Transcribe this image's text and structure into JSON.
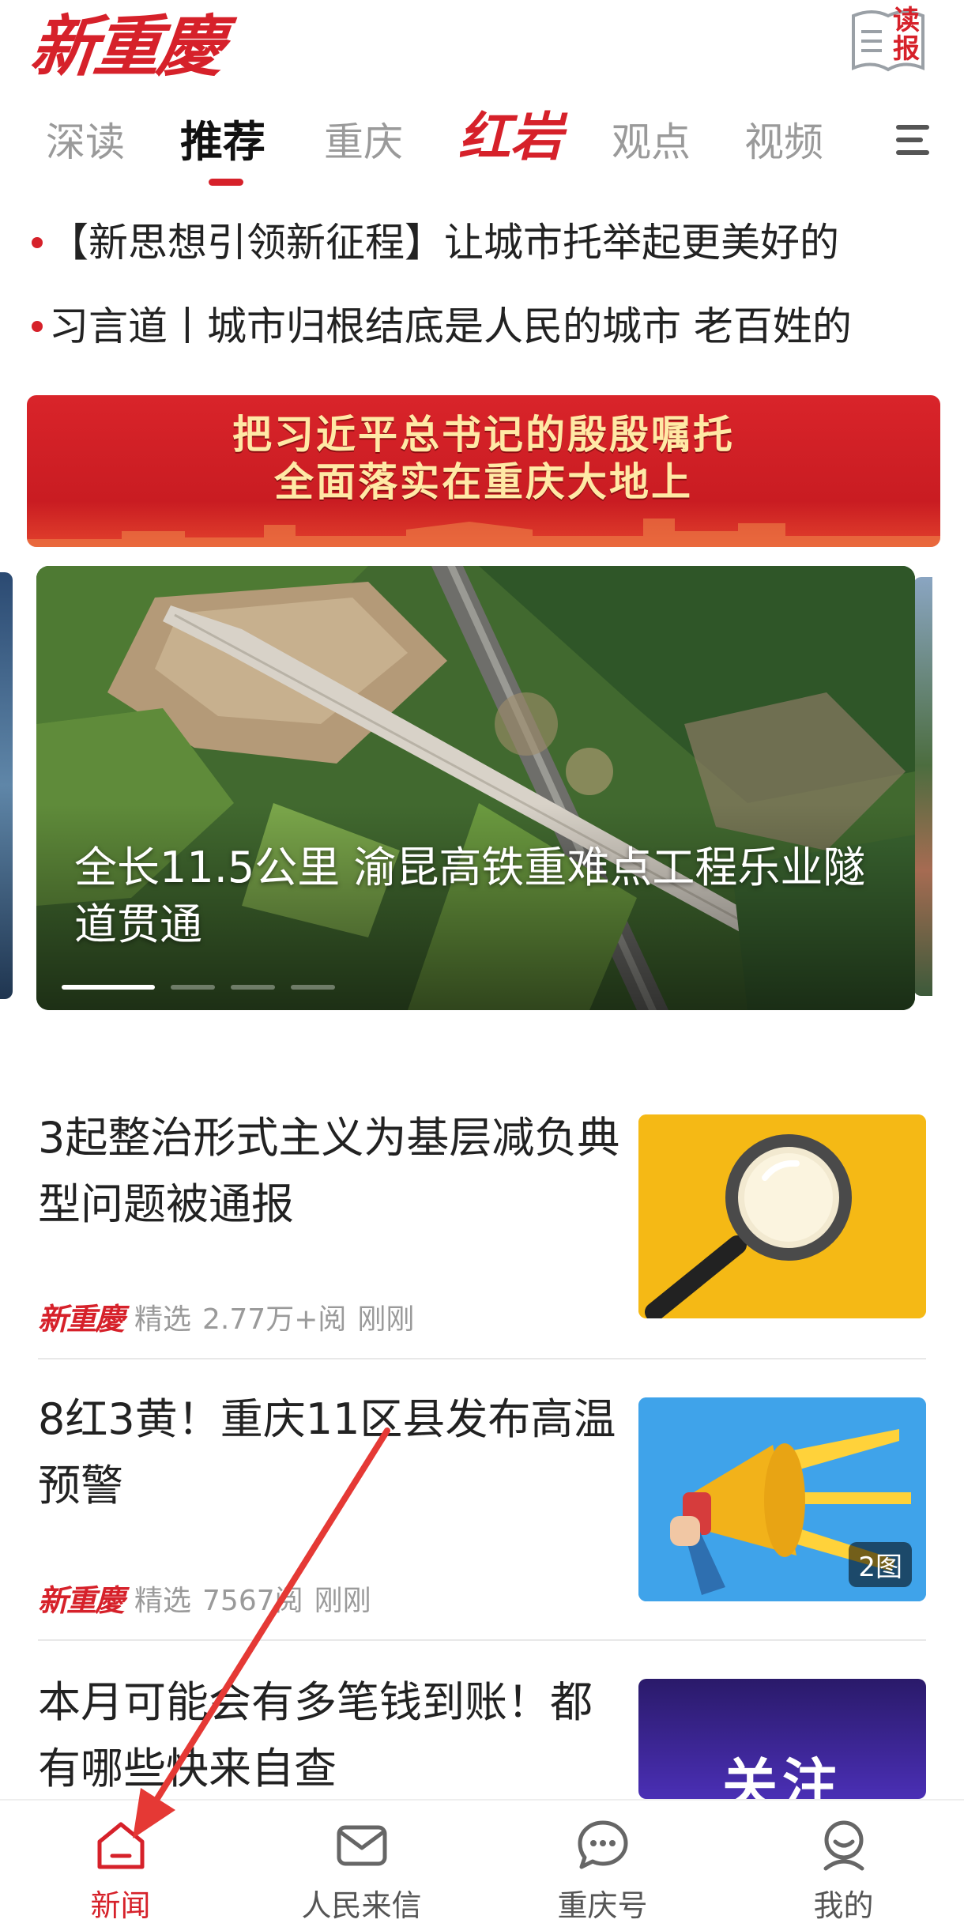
{
  "app": {
    "logo": "新重慶",
    "read_button_label": "读报"
  },
  "tabs": [
    {
      "label": "深读",
      "active": false
    },
    {
      "label": "推荐",
      "active": true
    },
    {
      "label": "重庆",
      "active": false
    },
    {
      "label": "红岩",
      "active": false,
      "brand": true
    },
    {
      "label": "观点",
      "active": false
    },
    {
      "label": "视频",
      "active": false
    }
  ],
  "headlines": [
    "【新思想引领新征程】让城市托举起更美好的",
    "习言道丨城市归根结底是人民的城市 老百姓的"
  ],
  "banner": {
    "line1": "把习近平总书记的殷殷嘱托",
    "line2": "全面落实在重庆大地上"
  },
  "carousel": {
    "caption": "全长11.5公里 渝昆高铁重难点工程乐业隧道贯通",
    "slide_count": 4,
    "active_index": 0
  },
  "articles": [
    {
      "title": "3起整治形式主义为基层减负典型问题被通报",
      "source": "新重慶",
      "tag": "精选",
      "reads": "2.77万+阅",
      "time": "刚刚",
      "thumb": "magnifier-icon"
    },
    {
      "title": "8红3黄！重庆11区县发布高温预警",
      "source": "新重慶",
      "tag": "精选",
      "reads": "7567阅",
      "time": "刚刚",
      "thumb": "megaphone-icon",
      "badge": "2图"
    },
    {
      "title": "本月可能会有多笔钱到账！都有哪些快来自查",
      "thumb_text": "关注"
    }
  ],
  "bottom_nav": [
    {
      "label": "新闻",
      "icon": "home-icon",
      "active": true
    },
    {
      "label": "人民来信",
      "icon": "mail-icon",
      "active": false
    },
    {
      "label": "重庆号",
      "icon": "chat-icon",
      "active": false
    },
    {
      "label": "我的",
      "icon": "profile-icon",
      "active": false
    }
  ],
  "colors": {
    "brand_red": "#d6212a",
    "text": "#222222",
    "muted": "#9a9a9a",
    "annotation_arrow": "#e53935"
  }
}
